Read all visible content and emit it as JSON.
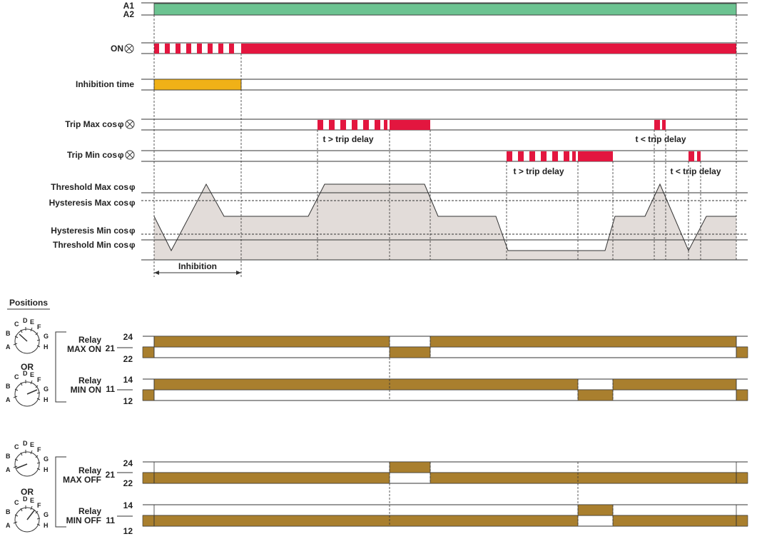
{
  "colors": {
    "supply": "#6cc391",
    "led": "#e3163f",
    "inhibition": "#f0b117",
    "relay": "#a97f2e",
    "wave_fill": "#e2dcd9",
    "line": "#333333"
  },
  "signals": {
    "a1": "A1",
    "a2": "A2",
    "on": "ON",
    "inhibition_time": "Inhibition time",
    "trip_max": "Trip Max cos",
    "trip_min": "Trip Min cos",
    "phi": "φ",
    "led_icon": "lamp-icon"
  },
  "thresholds": {
    "threshold_max": "Threshold Max cos",
    "hysteresis_max": "Hysteresis Max cos",
    "hysteresis_min": "Hysteresis Min cos",
    "threshold_min": "Threshold Min cos"
  },
  "annotations": {
    "gt_trip_delay": "t > trip delay",
    "lt_trip_delay": "t < trip delay",
    "inhibition": "Inhibition"
  },
  "positions": {
    "title": "Positions",
    "or": "OR",
    "letters": [
      "A",
      "B",
      "C",
      "D",
      "E",
      "F",
      "G",
      "H"
    ]
  },
  "relays": {
    "relay": "Relay",
    "max_on": "MAX ON",
    "min_on": "MIN ON",
    "max_off": "MAX OFF",
    "min_off": "MIN OFF",
    "t21": "21",
    "t22": "22",
    "t24": "24",
    "t11": "11",
    "t12": "12",
    "t14": "14"
  }
}
